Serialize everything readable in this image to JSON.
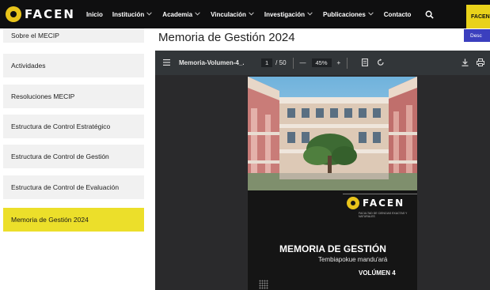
{
  "brand": {
    "logo_text": "FACEN"
  },
  "nav": {
    "items": [
      {
        "label": "Inicio",
        "dropdown": false
      },
      {
        "label": "Institución",
        "dropdown": true
      },
      {
        "label": "Academia",
        "dropdown": true
      },
      {
        "label": "Vinculación",
        "dropdown": true
      },
      {
        "label": "Investigación",
        "dropdown": true
      },
      {
        "label": "Publicaciones",
        "dropdown": true
      },
      {
        "label": "Contacto",
        "dropdown": false
      }
    ],
    "search_icon": "search-icon",
    "cta_label": "FACEN"
  },
  "sidebar": {
    "items": [
      {
        "label": "Sobre el MECIP",
        "active": false
      },
      {
        "label": "Actividades",
        "active": false
      },
      {
        "label": "Resoluciones MECIP",
        "active": false
      },
      {
        "label": "Estructura de Control Estratégico",
        "active": false
      },
      {
        "label": "Estructura de Control de Gestión",
        "active": false
      },
      {
        "label": "Estructura de Control de Evaluación",
        "active": false
      },
      {
        "label": "Memoria de Gestión 2024",
        "active": true
      }
    ],
    "active_color": "#ecdf2a"
  },
  "main": {
    "title": "Memoria de Gestión 2024",
    "side_button_label": "Desc"
  },
  "viewer": {
    "file_name": "Memoria-Volumen-4_...",
    "current_page": "1",
    "page_total": "/ 50",
    "zoom": "45%",
    "zoom_out": "—",
    "zoom_in": "+"
  },
  "cover": {
    "logo_text": "FACEN",
    "tagline": "FACULTAD DE CIENCIAS EXACTAS Y NATURALES",
    "title": "MEMORIA DE GESTIÓN",
    "subtitle": "Tembiapokue mandu'ará",
    "volume": "VOLÚMEN 4"
  },
  "colors": {
    "nav_bg": "#0f0f10",
    "accent_yellow": "#e9d21a",
    "accent_blue": "#3b3fbe",
    "viewer_toolbar": "#323639"
  }
}
